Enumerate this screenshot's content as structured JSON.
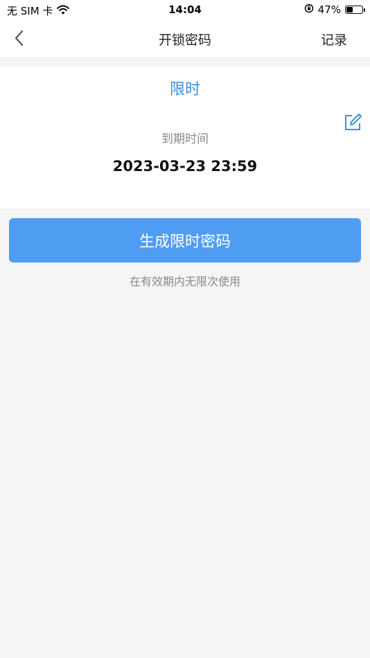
{
  "status_bar": {
    "carrier": "无 SIM 卡",
    "time": "14:04",
    "battery_percent_label": "47%",
    "battery_level": 0.47
  },
  "nav": {
    "back_icon": "chevron-left-icon",
    "title": "开锁密码",
    "record_label": "记录"
  },
  "card": {
    "mode_label": "限时",
    "edit_icon": "edit-icon",
    "expire_label": "到期时间",
    "expire_value": "2023-03-23 23:59"
  },
  "actions": {
    "generate_label": "生成限时密码",
    "hint": "在有效期内无限次使用"
  },
  "colors": {
    "accent": "#3b8fe0",
    "button": "#4f9df2",
    "background": "#f5f5f5"
  }
}
